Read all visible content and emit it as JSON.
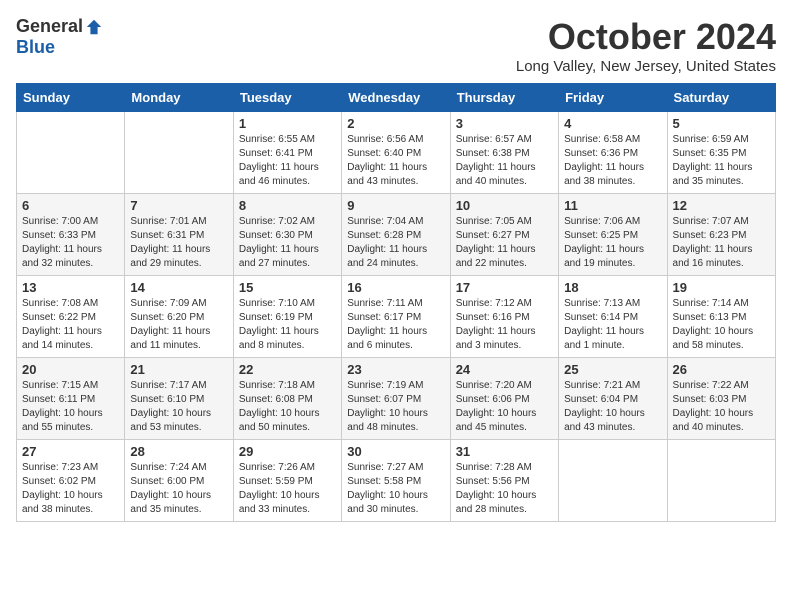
{
  "logo": {
    "general": "General",
    "blue": "Blue"
  },
  "title": "October 2024",
  "location": "Long Valley, New Jersey, United States",
  "days_of_week": [
    "Sunday",
    "Monday",
    "Tuesday",
    "Wednesday",
    "Thursday",
    "Friday",
    "Saturday"
  ],
  "weeks": [
    [
      {
        "day": "",
        "detail": ""
      },
      {
        "day": "",
        "detail": ""
      },
      {
        "day": "1",
        "detail": "Sunrise: 6:55 AM\nSunset: 6:41 PM\nDaylight: 11 hours and 46 minutes."
      },
      {
        "day": "2",
        "detail": "Sunrise: 6:56 AM\nSunset: 6:40 PM\nDaylight: 11 hours and 43 minutes."
      },
      {
        "day": "3",
        "detail": "Sunrise: 6:57 AM\nSunset: 6:38 PM\nDaylight: 11 hours and 40 minutes."
      },
      {
        "day": "4",
        "detail": "Sunrise: 6:58 AM\nSunset: 6:36 PM\nDaylight: 11 hours and 38 minutes."
      },
      {
        "day": "5",
        "detail": "Sunrise: 6:59 AM\nSunset: 6:35 PM\nDaylight: 11 hours and 35 minutes."
      }
    ],
    [
      {
        "day": "6",
        "detail": "Sunrise: 7:00 AM\nSunset: 6:33 PM\nDaylight: 11 hours and 32 minutes."
      },
      {
        "day": "7",
        "detail": "Sunrise: 7:01 AM\nSunset: 6:31 PM\nDaylight: 11 hours and 29 minutes."
      },
      {
        "day": "8",
        "detail": "Sunrise: 7:02 AM\nSunset: 6:30 PM\nDaylight: 11 hours and 27 minutes."
      },
      {
        "day": "9",
        "detail": "Sunrise: 7:04 AM\nSunset: 6:28 PM\nDaylight: 11 hours and 24 minutes."
      },
      {
        "day": "10",
        "detail": "Sunrise: 7:05 AM\nSunset: 6:27 PM\nDaylight: 11 hours and 22 minutes."
      },
      {
        "day": "11",
        "detail": "Sunrise: 7:06 AM\nSunset: 6:25 PM\nDaylight: 11 hours and 19 minutes."
      },
      {
        "day": "12",
        "detail": "Sunrise: 7:07 AM\nSunset: 6:23 PM\nDaylight: 11 hours and 16 minutes."
      }
    ],
    [
      {
        "day": "13",
        "detail": "Sunrise: 7:08 AM\nSunset: 6:22 PM\nDaylight: 11 hours and 14 minutes."
      },
      {
        "day": "14",
        "detail": "Sunrise: 7:09 AM\nSunset: 6:20 PM\nDaylight: 11 hours and 11 minutes."
      },
      {
        "day": "15",
        "detail": "Sunrise: 7:10 AM\nSunset: 6:19 PM\nDaylight: 11 hours and 8 minutes."
      },
      {
        "day": "16",
        "detail": "Sunrise: 7:11 AM\nSunset: 6:17 PM\nDaylight: 11 hours and 6 minutes."
      },
      {
        "day": "17",
        "detail": "Sunrise: 7:12 AM\nSunset: 6:16 PM\nDaylight: 11 hours and 3 minutes."
      },
      {
        "day": "18",
        "detail": "Sunrise: 7:13 AM\nSunset: 6:14 PM\nDaylight: 11 hours and 1 minute."
      },
      {
        "day": "19",
        "detail": "Sunrise: 7:14 AM\nSunset: 6:13 PM\nDaylight: 10 hours and 58 minutes."
      }
    ],
    [
      {
        "day": "20",
        "detail": "Sunrise: 7:15 AM\nSunset: 6:11 PM\nDaylight: 10 hours and 55 minutes."
      },
      {
        "day": "21",
        "detail": "Sunrise: 7:17 AM\nSunset: 6:10 PM\nDaylight: 10 hours and 53 minutes."
      },
      {
        "day": "22",
        "detail": "Sunrise: 7:18 AM\nSunset: 6:08 PM\nDaylight: 10 hours and 50 minutes."
      },
      {
        "day": "23",
        "detail": "Sunrise: 7:19 AM\nSunset: 6:07 PM\nDaylight: 10 hours and 48 minutes."
      },
      {
        "day": "24",
        "detail": "Sunrise: 7:20 AM\nSunset: 6:06 PM\nDaylight: 10 hours and 45 minutes."
      },
      {
        "day": "25",
        "detail": "Sunrise: 7:21 AM\nSunset: 6:04 PM\nDaylight: 10 hours and 43 minutes."
      },
      {
        "day": "26",
        "detail": "Sunrise: 7:22 AM\nSunset: 6:03 PM\nDaylight: 10 hours and 40 minutes."
      }
    ],
    [
      {
        "day": "27",
        "detail": "Sunrise: 7:23 AM\nSunset: 6:02 PM\nDaylight: 10 hours and 38 minutes."
      },
      {
        "day": "28",
        "detail": "Sunrise: 7:24 AM\nSunset: 6:00 PM\nDaylight: 10 hours and 35 minutes."
      },
      {
        "day": "29",
        "detail": "Sunrise: 7:26 AM\nSunset: 5:59 PM\nDaylight: 10 hours and 33 minutes."
      },
      {
        "day": "30",
        "detail": "Sunrise: 7:27 AM\nSunset: 5:58 PM\nDaylight: 10 hours and 30 minutes."
      },
      {
        "day": "31",
        "detail": "Sunrise: 7:28 AM\nSunset: 5:56 PM\nDaylight: 10 hours and 28 minutes."
      },
      {
        "day": "",
        "detail": ""
      },
      {
        "day": "",
        "detail": ""
      }
    ]
  ]
}
